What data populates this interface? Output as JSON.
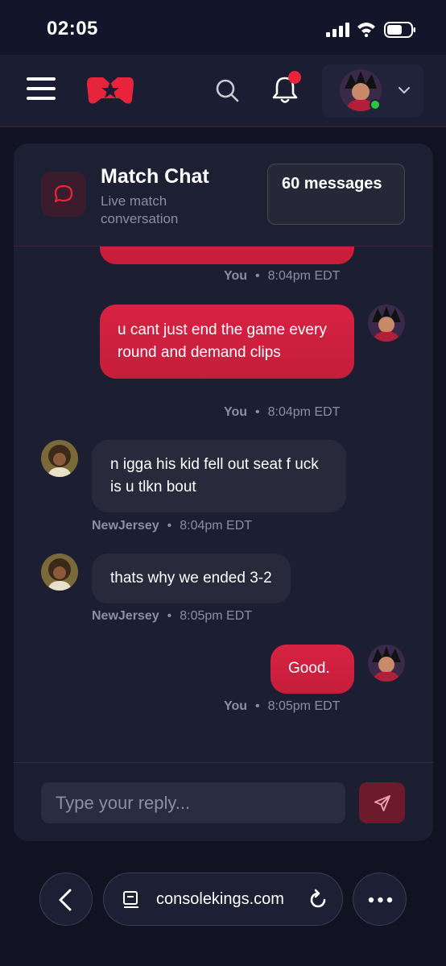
{
  "status_bar": {
    "time": "02:05"
  },
  "navbar": {
    "logo": "consolekings-crown-logo"
  },
  "chat": {
    "title": "Match Chat",
    "subtitle": "Live match conversation",
    "message_count": "60 messages",
    "messages": [
      {
        "sender": "You",
        "time": "8:04pm EDT",
        "text": ""
      },
      {
        "sender": "You",
        "time": "8:04pm EDT",
        "text": "u cant just end the game every round and demand clips"
      },
      {
        "sender": "NewJersey",
        "time": "8:04pm EDT",
        "text": "n igga his kid fell out seat f uck is u tlkn bout"
      },
      {
        "sender": "NewJersey",
        "time": "8:05pm EDT",
        "text": "thats why we ended 3-2"
      },
      {
        "sender": "You",
        "time": "8:05pm EDT",
        "text": "Good."
      }
    ],
    "reply_placeholder": "Type your reply..."
  },
  "browser": {
    "url": "consolekings.com"
  },
  "colors": {
    "accent": "#d72343",
    "background": "#111322",
    "card": "#1c1e31",
    "online": "#27c93f"
  }
}
